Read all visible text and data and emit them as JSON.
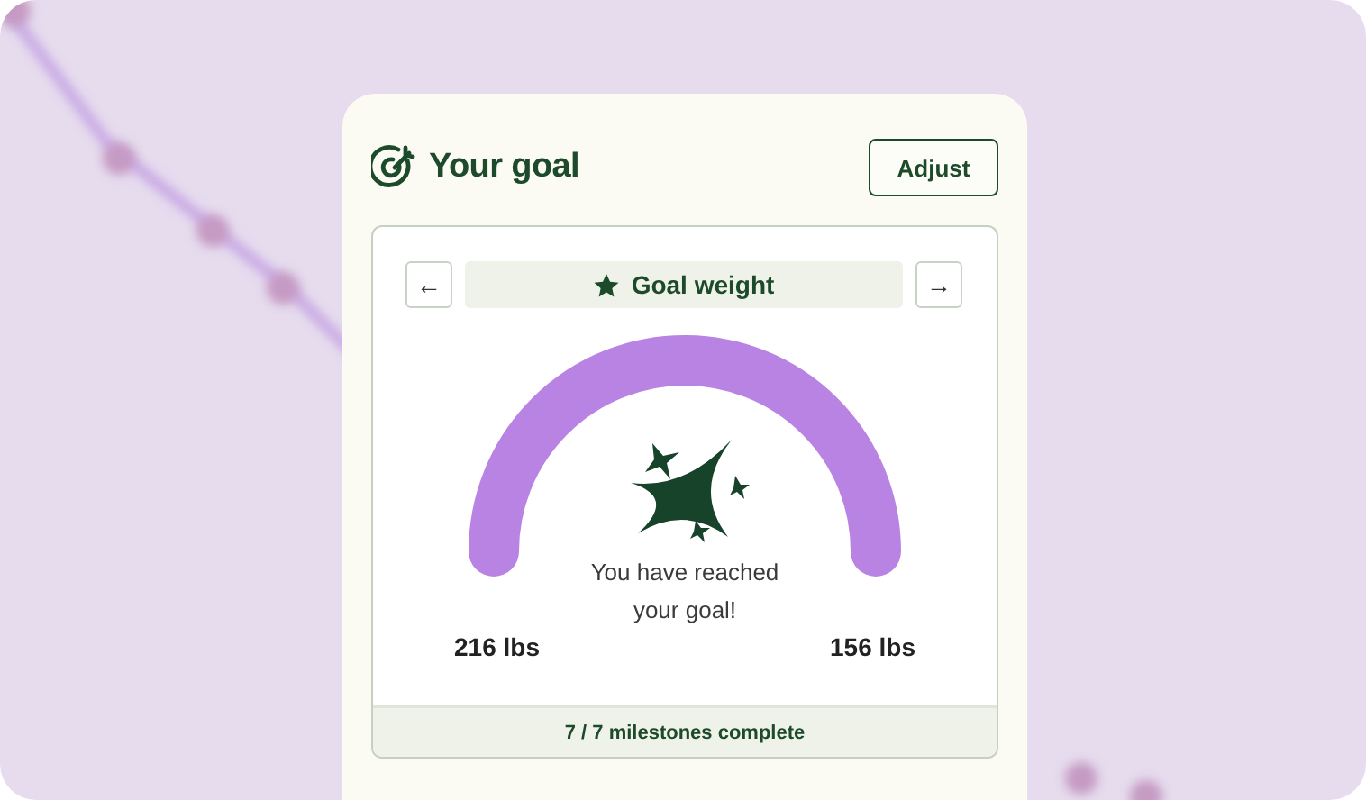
{
  "header": {
    "title": "Your goal",
    "button": "Adjust"
  },
  "navigator": {
    "prev": "←",
    "label": "Goal weight",
    "next": "→"
  },
  "gauge": {
    "message": "You have reached your goal!",
    "start_label": "216 lbs",
    "end_label": "156 lbs"
  },
  "footer": {
    "milestones": "7 / 7 milestones complete"
  }
}
